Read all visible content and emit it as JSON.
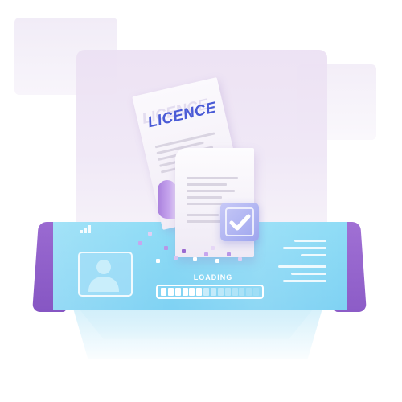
{
  "document_title": "LICENCE",
  "loading": {
    "label": "LOADING",
    "progress": 0.42,
    "cell_count": 14
  },
  "colors": {
    "accent_purple": "#8c5cc7",
    "screen_blue": "#86d7f5",
    "title_blue": "#4a5bd6",
    "panel_lilac": "#ece1f3"
  },
  "icons": {
    "signal": "signal-bars-icon",
    "avatar": "user-silhouette-icon",
    "check": "checkmark-icon"
  }
}
